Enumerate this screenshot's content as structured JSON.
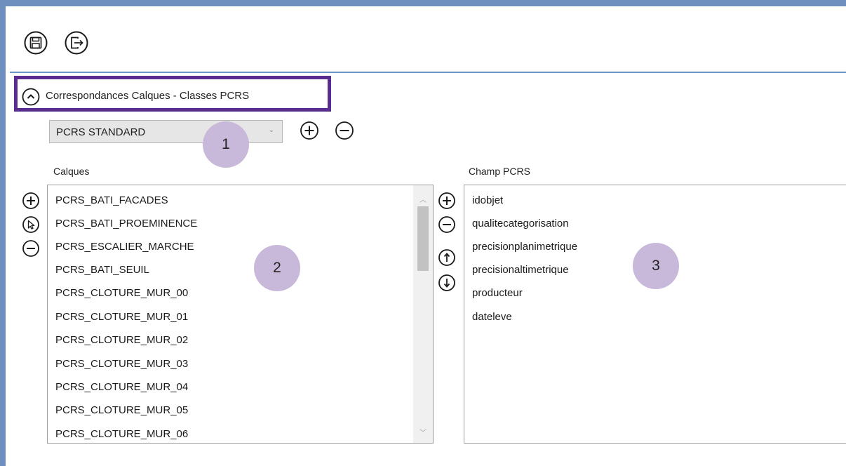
{
  "toolbar": {
    "save_icon": "floppy-disk-icon",
    "export_icon": "exit-icon"
  },
  "section": {
    "title": "Correspondances Calques - Classes PCRS",
    "toggle_icon": "chevron-up-icon"
  },
  "profile": {
    "selected": "PCRS STANDARD",
    "arrow": "⌄"
  },
  "calques": {
    "label": "Calques",
    "items": [
      "PCRS_BATI_FACADES",
      "PCRS_BATI_PROEMINENCE",
      "PCRS_ESCALIER_MARCHE",
      "PCRS_BATI_SEUIL",
      "PCRS_CLOTURE_MUR_00",
      "PCRS_CLOTURE_MUR_01",
      "PCRS_CLOTURE_MUR_02",
      "PCRS_CLOTURE_MUR_03",
      "PCRS_CLOTURE_MUR_04",
      "PCRS_CLOTURE_MUR_05",
      "PCRS_CLOTURE_MUR_06"
    ],
    "scroll_up": "︿",
    "scroll_down": "﹀"
  },
  "champ": {
    "label": "Champ PCRS",
    "items": [
      "idobjet",
      "qualitecategorisation",
      "precisionplanimetrique",
      "precisionaltimetrique",
      "producteur",
      "dateleve"
    ]
  },
  "badges": [
    "1",
    "2",
    "3"
  ],
  "colors": {
    "frame": "#6f8fbf",
    "highlight_border": "#5b2c8f",
    "badge_fill": "#c8b8da"
  }
}
